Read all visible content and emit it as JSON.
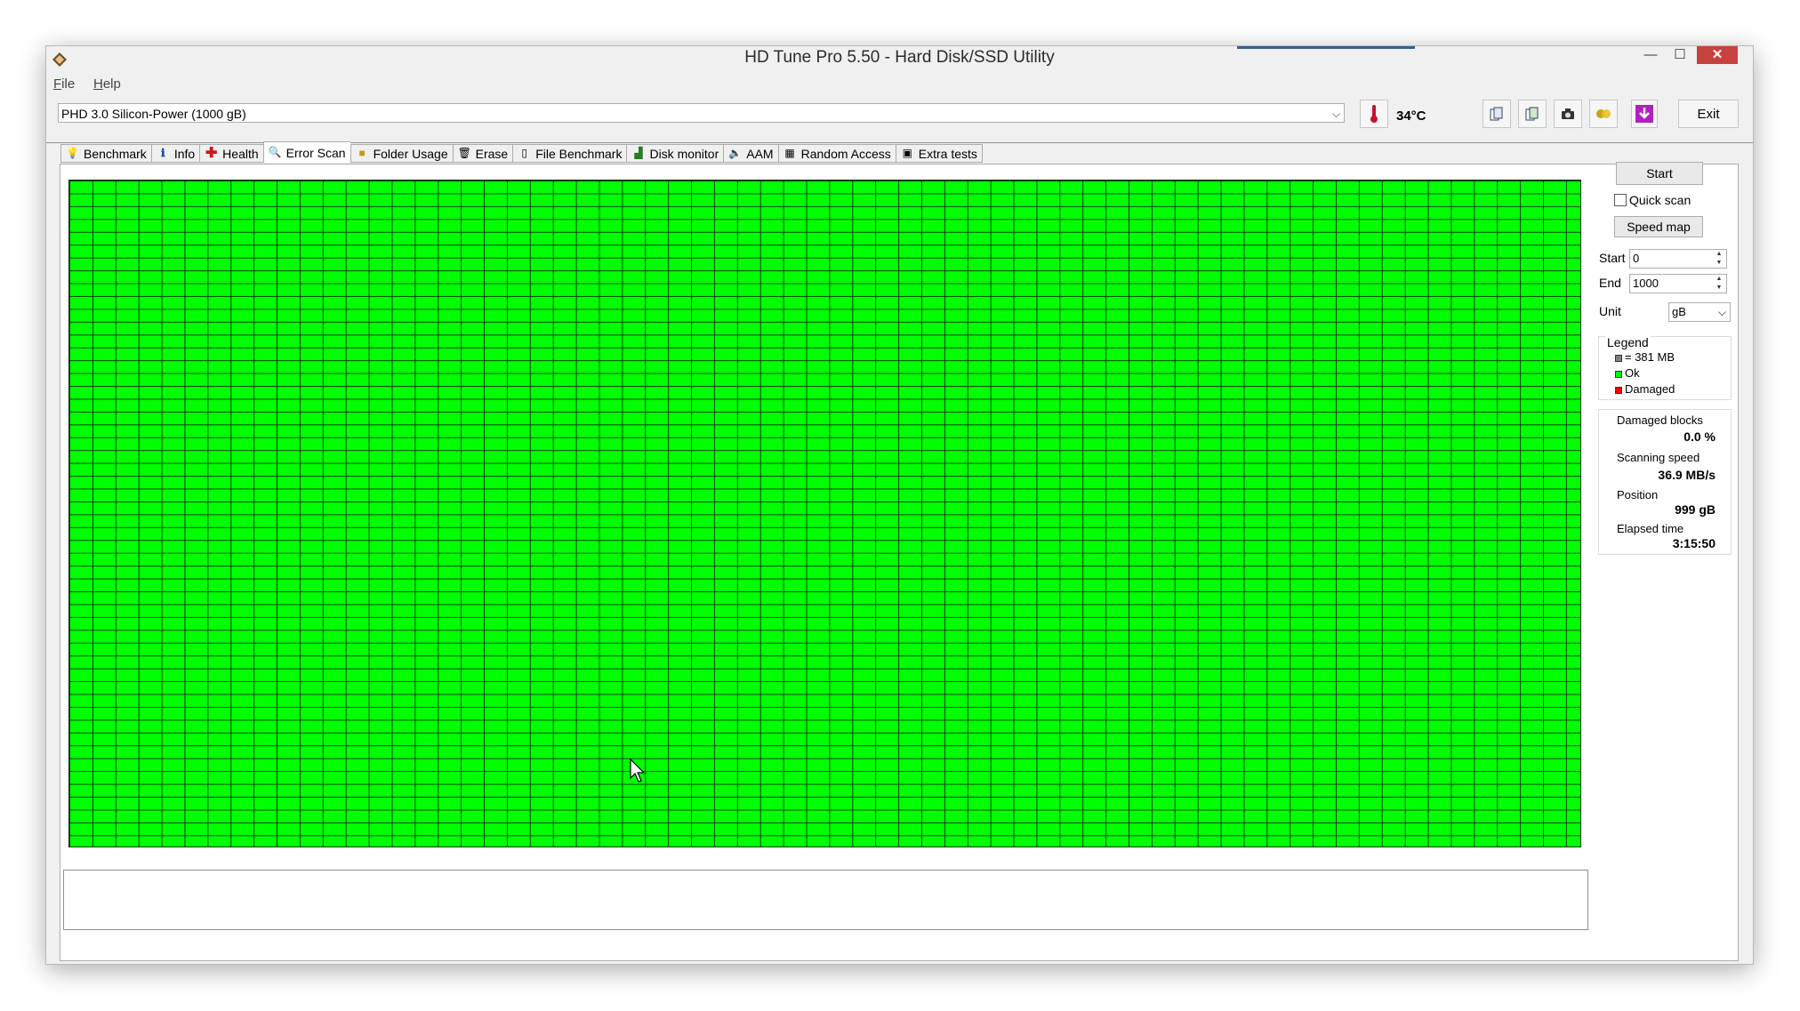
{
  "window": {
    "title": "HD Tune Pro 5.50 - Hard Disk/SSD Utility",
    "controls": {
      "minimize": "—",
      "maximize": "☐",
      "close": "✕"
    }
  },
  "menu": [
    {
      "key": "F",
      "rest": "ile"
    },
    {
      "key": "H",
      "rest": "elp"
    }
  ],
  "toolbar": {
    "drive": "PHD 3.0 Silicon-Power (1000 gB)",
    "temperature": "34°C",
    "exit_label": "Exit"
  },
  "tabs": [
    {
      "label": "Benchmark",
      "icon": "benchmark-icon"
    },
    {
      "label": "Info",
      "icon": "info-icon"
    },
    {
      "label": "Health",
      "icon": "health-icon"
    },
    {
      "label": "Error Scan",
      "icon": "error-scan-icon",
      "active": true
    },
    {
      "label": "Folder Usage",
      "icon": "folder-icon"
    },
    {
      "label": "Erase",
      "icon": "erase-icon"
    },
    {
      "label": "File Benchmark",
      "icon": "file-benchmark-icon"
    },
    {
      "label": "Disk monitor",
      "icon": "disk-monitor-icon"
    },
    {
      "label": "AAM",
      "icon": "aam-icon"
    },
    {
      "label": "Random Access",
      "icon": "random-access-icon"
    },
    {
      "label": "Extra tests",
      "icon": "extra-tests-icon"
    }
  ],
  "scan": {
    "start_button": "Start",
    "quick_scan_label": "Quick scan",
    "quick_scan_checked": false,
    "speed_map_button": "Speed map",
    "start_label": "Start",
    "start_value": "0",
    "end_label": "End",
    "end_value": "1000",
    "unit_label": "Unit",
    "unit_value": "gB"
  },
  "legend": {
    "title": "Legend",
    "block_size": "= 381 MB",
    "ok": "Ok",
    "damaged": "Damaged",
    "colors": {
      "block": "#808080",
      "ok": "#00ff00",
      "damaged": "#ff0000"
    }
  },
  "stats": {
    "damaged_blocks_label": "Damaged blocks",
    "damaged_blocks_value": "0.0 %",
    "scanning_speed_label": "Scanning speed",
    "scanning_speed_value": "36.9 MB/s",
    "position_label": "Position",
    "position_value": "999 gB",
    "elapsed_time_label": "Elapsed time",
    "elapsed_time_value": "3:15:50"
  },
  "grid": {
    "ok_color": "#00ff00",
    "damaged_blocks": 0
  }
}
